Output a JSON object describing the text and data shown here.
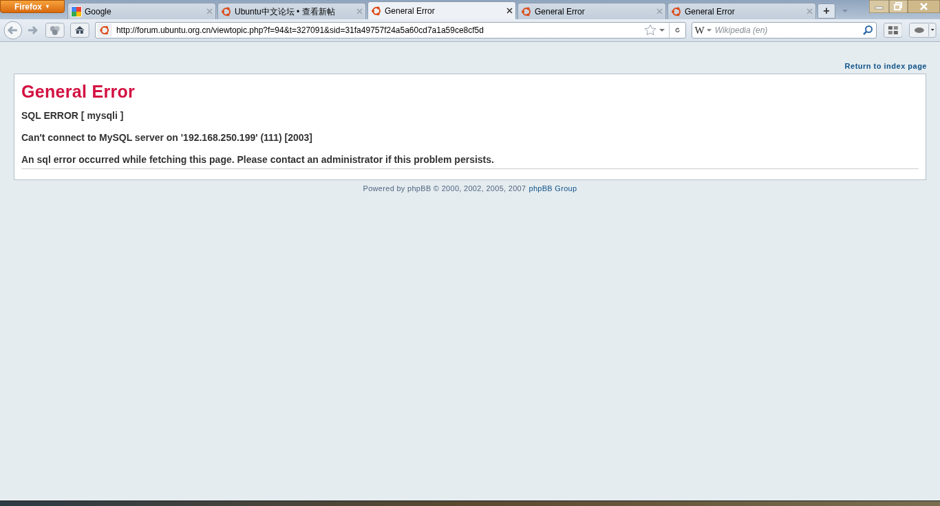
{
  "app_button": {
    "label": "Firefox",
    "caret": "▼"
  },
  "tabs": [
    {
      "label": "Google",
      "kind": "google",
      "selected": false
    },
    {
      "label": "Ubuntu中文论坛 • 查看新帖",
      "kind": "ubuntu",
      "selected": false
    },
    {
      "label": "General Error",
      "kind": "ubuntu",
      "selected": true
    },
    {
      "label": "General Error",
      "kind": "ubuntu",
      "selected": false
    },
    {
      "label": "General Error",
      "kind": "ubuntu",
      "selected": false
    }
  ],
  "new_tab": "+",
  "address_bar": {
    "value": "http://forum.ubuntu.org.cn/viewtopic.php?f=94&t=327091&sid=31fa49757f24a5a60cd7a1a59ce8cf5d"
  },
  "search": {
    "engine": "W",
    "placeholder": "Wikipedia (en)"
  },
  "page": {
    "return_link": "Return to index page",
    "heading": "General Error",
    "messages": [
      "SQL ERROR [ mysqli ]",
      "Can't connect to MySQL server on '192.168.250.199' (111) [2003]",
      "An sql error occurred while fetching this page. Please contact an administrator if this problem persists."
    ],
    "footer": {
      "text": "Powered by phpBB © 2000, 2002, 2005, 2007",
      "link": "phpBB Group"
    }
  }
}
